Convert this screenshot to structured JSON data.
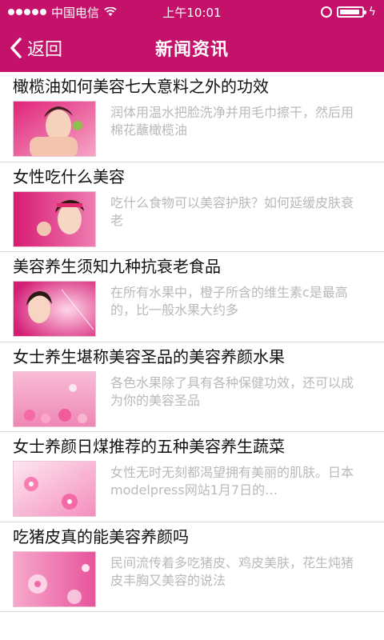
{
  "status": {
    "carrier": "中国电信",
    "time": "上午10:01"
  },
  "nav": {
    "back_label": "返回",
    "title": "新闻资讯"
  },
  "colors": {
    "brand": "#c4126b",
    "desc_text": "#b9b9b9"
  },
  "articles": [
    {
      "title": "橄榄油如何美容七大意料之外的功效",
      "summary": "润体用温水把脸洗净并用毛巾擦干，然后用棉花蘸橄榄油"
    },
    {
      "title": "女性吃什么美容",
      "summary": "吃什么食物可以美容护肤？如何延缓皮肤衰老"
    },
    {
      "title": "美容养生须知九种抗衰老食品",
      "summary": "在所有水果中，橙子所含的维生素c是最高的，比一般水果大约多"
    },
    {
      "title": "女士养生堪称美容圣品的美容养颜水果",
      "summary": "各色水果除了具有各种保健功效，还可以成为你的美容圣品"
    },
    {
      "title": "女士养颜日煤推荐的五种美容养生蔬菜",
      "summary": "女性无时无刻都渴望拥有美丽的肌肤。日本modelpress网站1月7日的…"
    },
    {
      "title": "吃猪皮真的能美容养颜吗",
      "summary": "民间流传着多吃猪皮、鸡皮美肤，花生炖猪皮丰胸又美容的说法"
    }
  ]
}
